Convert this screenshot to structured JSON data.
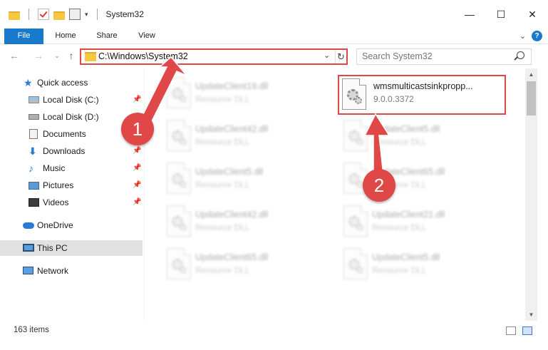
{
  "window": {
    "title": "System32",
    "minimize_glyph": "—",
    "maximize_glyph": "☐",
    "close_glyph": "✕"
  },
  "ribbon": {
    "tabs": [
      {
        "label": "File"
      },
      {
        "label": "Home"
      },
      {
        "label": "Share"
      },
      {
        "label": "View"
      }
    ],
    "help_glyph": "?"
  },
  "nav": {
    "address": "C:\\Windows\\System32",
    "search_placeholder": "Search System32"
  },
  "sidebar": {
    "items": [
      {
        "label": "Quick access",
        "icon": "star-icon"
      },
      {
        "label": "Local Disk (C:)",
        "icon": "drive-icon",
        "pinned": true
      },
      {
        "label": "Local Disk (D:)",
        "icon": "drive-icon"
      },
      {
        "label": "Documents",
        "icon": "documents-icon",
        "pinned": true
      },
      {
        "label": "Downloads",
        "icon": "download-icon",
        "pinned": true
      },
      {
        "label": "Music",
        "icon": "music-icon",
        "pinned": true
      },
      {
        "label": "Pictures",
        "icon": "pictures-icon",
        "pinned": true
      },
      {
        "label": "Videos",
        "icon": "videos-icon",
        "pinned": true
      },
      {
        "label": "OneDrive",
        "icon": "onedrive-icon"
      },
      {
        "label": "This PC",
        "icon": "pc-icon",
        "selected": true
      },
      {
        "label": "Network",
        "icon": "network-icon"
      }
    ]
  },
  "files": {
    "highlighted": {
      "name": "wmsmulticastsinkpropp...",
      "detail": "9.0.0.3372"
    },
    "left_column": [
      {
        "name": "UpdateClient19.dll",
        "detail": "Resource DLL"
      },
      {
        "name": "UpdateClient42.dll",
        "detail": "Resource DLL"
      },
      {
        "name": "UpdateClient5.dll",
        "detail": "Resource DLL"
      },
      {
        "name": "UpdateClient42.dll",
        "detail": "Resource DLL"
      },
      {
        "name": "UpdateClient65.dll",
        "detail": "Resource DLL"
      }
    ],
    "right_column": [
      {
        "name": "UpdateClient5.dll",
        "detail": "Resource DLL"
      },
      {
        "name": "UpdateClient65.dll",
        "detail": "Resource DLL"
      },
      {
        "name": "UpdateClient21.dll",
        "detail": "Resource DLL"
      },
      {
        "name": "UpdateClient5.dll",
        "detail": "Resource DLL"
      }
    ]
  },
  "status": {
    "item_count": "163 items"
  },
  "callouts": {
    "step1": "1",
    "step2": "2",
    "color": "#e04848"
  }
}
